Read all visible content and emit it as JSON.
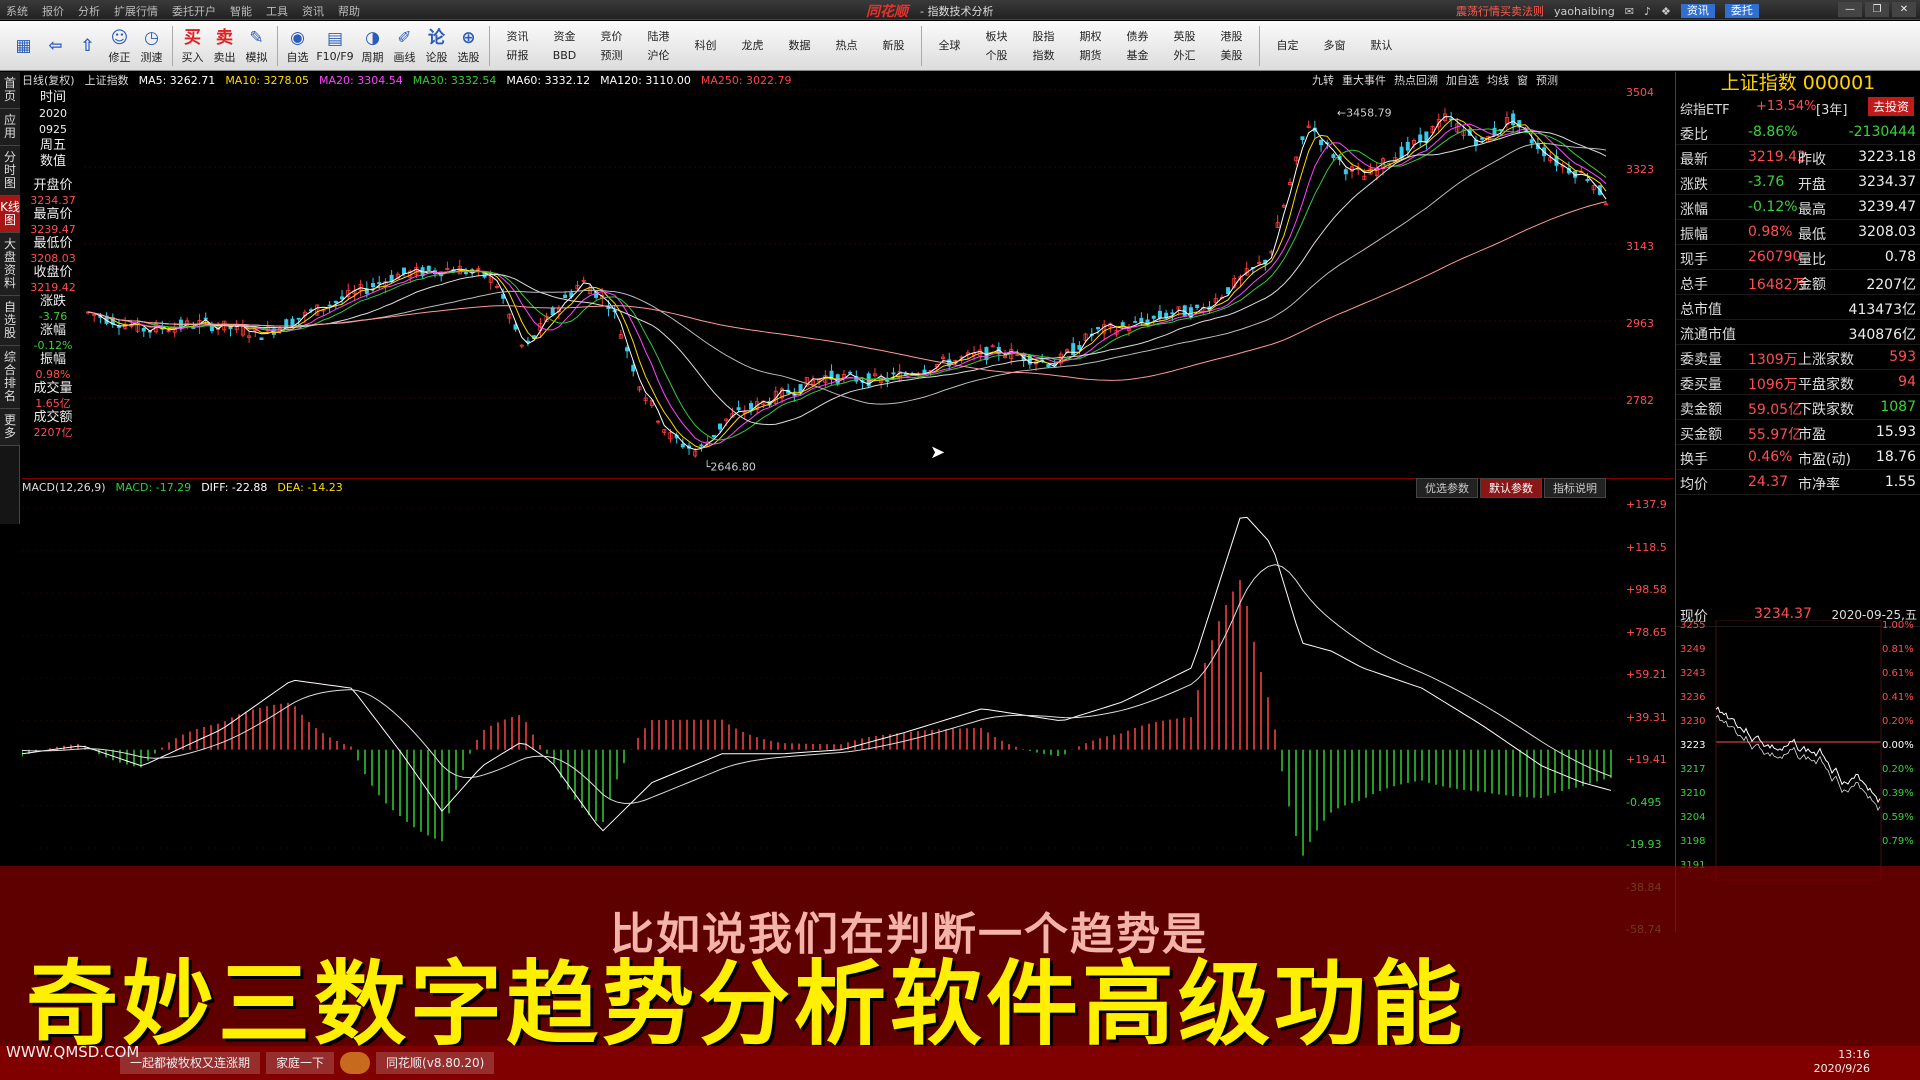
{
  "menubar": {
    "items": [
      "系统",
      "报价",
      "分析",
      "扩展行情",
      "委托开户",
      "智能",
      "工具",
      "资讯",
      "帮助"
    ],
    "app_name": "同花顺",
    "title": "- 指数技术分析",
    "right_link": "震荡行情买卖法则",
    "user": "yaohaibing",
    "btn_news": "资讯",
    "btn_trade": "委托"
  },
  "toolbar": {
    "buttons": [
      {
        "icon": "▦",
        "label": ""
      },
      {
        "icon": "⇦",
        "label": ""
      },
      {
        "icon": "⇧",
        "label": ""
      },
      {
        "icon": "☺",
        "label": "修正"
      },
      {
        "icon": "◷",
        "label": "测速"
      },
      {
        "icon": "买",
        "label": "买入"
      },
      {
        "icon": "卖",
        "label": "卖出"
      },
      {
        "icon": "✎",
        "label": "模拟"
      },
      {
        "icon": "◉",
        "label": "自选"
      },
      {
        "icon": "▤",
        "label": "F10/F9"
      },
      {
        "icon": "◑",
        "label": "周期"
      },
      {
        "icon": "✐",
        "label": "画线"
      },
      {
        "icon": "论",
        "label": "论股"
      },
      {
        "icon": "⊕",
        "label": "选股"
      }
    ],
    "grid": [
      [
        "资讯",
        "研报"
      ],
      [
        "资金",
        "BBD"
      ],
      [
        "竞价",
        "预测"
      ],
      [
        "陆港",
        "沪伦"
      ],
      [
        "科创",
        ""
      ],
      [
        "龙虎",
        ""
      ],
      [
        "数据",
        ""
      ],
      [
        "热点",
        ""
      ],
      [
        "新股",
        ""
      ],
      [
        "全球",
        ""
      ],
      [
        "板块",
        "个股"
      ],
      [
        "股指",
        "指数"
      ],
      [
        "期权",
        "期货"
      ],
      [
        "债券",
        "基金"
      ],
      [
        "英股",
        "外汇"
      ],
      [
        "港股",
        "美股"
      ],
      [
        "自定",
        ""
      ],
      [
        "多窗",
        ""
      ],
      [
        "默认",
        ""
      ]
    ]
  },
  "sidetabs": [
    "首页",
    "应用",
    "分时图",
    "K线图",
    "大盘资料",
    "自选股",
    "综合排名",
    "更多"
  ],
  "legend1": {
    "prefix": "日线(复权)",
    "name": "上证指数",
    "ma": [
      {
        "label": "MA5: 3262.71",
        "color": "#ffffff"
      },
      {
        "label": "MA10: 3278.05",
        "color": "#ffdd00"
      },
      {
        "label": "MA20: 3304.54",
        "color": "#ff44ff"
      },
      {
        "label": "MA30: 3332.54",
        "color": "#33cc33"
      },
      {
        "label": "MA60: 3332.12",
        "color": "#ffffff"
      },
      {
        "label": "MA120: 3110.00",
        "color": "#ffffff"
      },
      {
        "label": "MA250: 3022.79",
        "color": "#ff4444"
      }
    ]
  },
  "legend1b": [
    "九转",
    "重大事件",
    "热点回溯",
    "加自选",
    "均线",
    "窗",
    "预测"
  ],
  "info": {
    "time_label": "时间",
    "year": "2020",
    "date": "0925",
    "weekday": "周五",
    "values_label": "数值",
    "open_label": "开盘价",
    "open": "3234.37",
    "high_label": "最高价",
    "high": "3239.47",
    "low_label": "最低价",
    "low": "3208.03",
    "close_label": "收盘价",
    "close": "3219.42",
    "chg_label": "涨跌",
    "chg": "-3.76",
    "pct_label": "涨幅",
    "pct": "-0.12%",
    "amp_label": "振幅",
    "amp": "0.98%",
    "vol_label": "成交量",
    "vol": "1.65亿",
    "amt_label": "成交额",
    "amt": "2207亿"
  },
  "yaxis1": [
    "3504",
    "3323",
    "3143",
    "2963",
    "2782"
  ],
  "chart_data": [
    {
      "type": "candlestick",
      "title": "上证指数",
      "annotations": [
        "3458.79",
        "2646.80"
      ]
    },
    {
      "type": "bar+line",
      "title": "MACD(12,26,9)",
      "series": [
        {
          "name": "MACD",
          "values": [
            -17.29
          ]
        },
        {
          "name": "DIFF",
          "values": [
            -22.88
          ]
        },
        {
          "name": "DEA",
          "values": [
            -14.23
          ]
        }
      ]
    }
  ],
  "legend2": {
    "name": "MACD(12,26,9)",
    "macd": "MACD: -17.29",
    "diff": "DIFF: -22.88",
    "dea": "DEA: -14.23"
  },
  "btns2": [
    "优选参数",
    "默认参数",
    "指标说明"
  ],
  "yaxis2": [
    "+137.9",
    "+118.5",
    "+98.58",
    "+78.65",
    "+59.21",
    "+39.31",
    "+19.41",
    "-0.495",
    "-19.93",
    "-38.84",
    "-58.74"
  ],
  "right": {
    "title": "上证指数 000001",
    "etf_label": "综指ETF",
    "etf_chg": "+13.54%",
    "etf_period": "[3年]",
    "etf_btn": "去投资",
    "rows": [
      [
        "委比",
        "-8.86%",
        "",
        "-2130444"
      ],
      [
        "最新",
        "3219.42",
        "昨收",
        "3223.18"
      ],
      [
        "涨跌",
        "-3.76",
        "开盘",
        "3234.37"
      ],
      [
        "涨幅",
        "-0.12%",
        "最高",
        "3239.47"
      ],
      [
        "振幅",
        "0.98%",
        "最低",
        "3208.03"
      ],
      [
        "现手",
        "260790",
        "量比",
        "0.78"
      ],
      [
        "总手",
        "16482万",
        "金额",
        "2207亿"
      ],
      [
        "总市值",
        "",
        "",
        "413473亿"
      ],
      [
        "流通市值",
        "",
        "",
        "340876亿"
      ],
      [
        "委卖量",
        "1309万",
        "上涨家数",
        "593"
      ],
      [
        "委买量",
        "1096万",
        "平盘家数",
        "94"
      ],
      [
        "卖金额",
        "59.05亿",
        "下跌家数",
        "1087"
      ],
      [
        "买金额",
        "55.97亿",
        "市盈",
        "15.93"
      ],
      [
        "换手",
        "0.46%",
        "市盈(动)",
        "18.76"
      ],
      [
        "均价",
        "24.37",
        "市净率",
        "1.55"
      ]
    ],
    "now_label": "现价",
    "now_val": "3234.37",
    "now_date": "2020-09-25,五",
    "mini_left": [
      "3255",
      "3249",
      "3243",
      "3236",
      "3230",
      "3223",
      "3217",
      "3210",
      "3204",
      "3198",
      "3191"
    ],
    "mini_right": [
      "1.00%",
      "0.81%",
      "0.61%",
      "0.41%",
      "0.20%",
      "0.00%",
      "0.20%",
      "0.39%",
      "0.59%",
      "0.79%"
    ]
  },
  "overlay": {
    "subtitle": "比如说我们在判断一个趋势是",
    "title": "奇妙三数字趋势分析软件高级功能"
  },
  "watermark": "WWW.QMSD.COM",
  "taskbar": {
    "items": [
      "一起都被牧权又连涨期",
      "家庭一下",
      "",
      "同花顺(v8.80.20)"
    ],
    "time": "13:16",
    "date": "2020/9/26"
  }
}
